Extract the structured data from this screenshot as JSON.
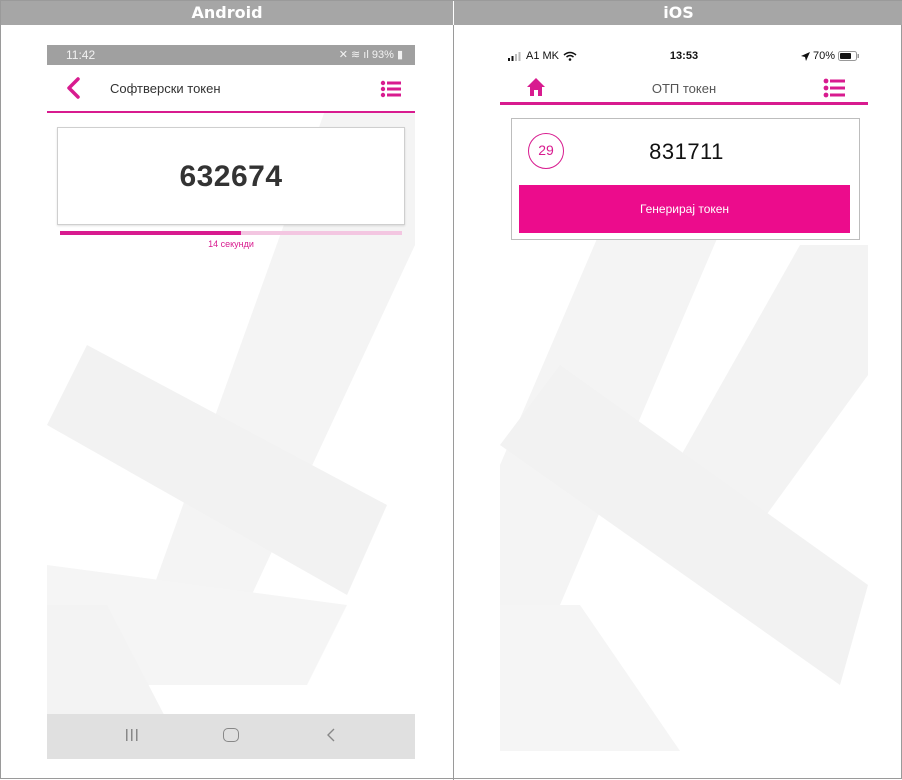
{
  "header": {
    "android_label": "Android",
    "ios_label": "iOS"
  },
  "android": {
    "status": {
      "time": "11:42",
      "battery": "93%"
    },
    "appbar": {
      "title": "Софтверски токен"
    },
    "token": {
      "code": "632674",
      "seconds_label": "14 секунди",
      "progress_fraction": 0.53
    },
    "icons": {
      "back": "chevron-left-icon",
      "menu": "list-menu-icon"
    }
  },
  "ios": {
    "status": {
      "carrier": "A1 MK",
      "time": "13:53",
      "battery": "70%"
    },
    "navbar": {
      "title": "ОТП токен"
    },
    "token": {
      "timer": "29",
      "code": "831711",
      "generate_button": "Генерирај токен"
    },
    "icons": {
      "home": "home-icon",
      "menu": "list-menu-icon"
    }
  },
  "colors": {
    "accent": "#d81b8f",
    "button": "#ec0c8c",
    "header_bar": "#a6a6a6"
  }
}
